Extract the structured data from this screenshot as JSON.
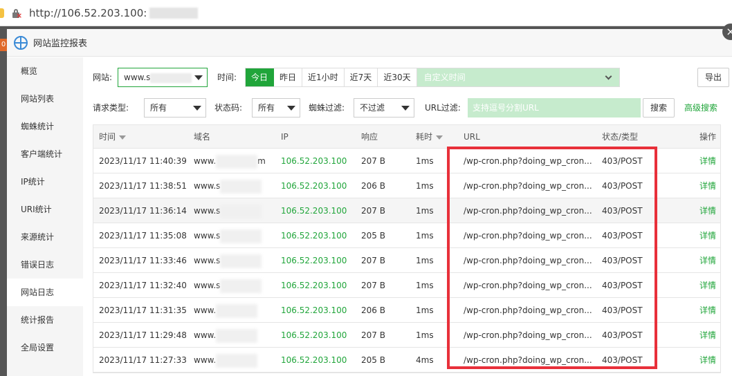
{
  "browser": {
    "url": "http://106.52.203.100:"
  },
  "dialog": {
    "title": "网站监控报表",
    "close_symbol": "×"
  },
  "sidebar": {
    "items": [
      {
        "label": "概览"
      },
      {
        "label": "网站列表"
      },
      {
        "label": "蜘蛛统计"
      },
      {
        "label": "客户端统计"
      },
      {
        "label": "IP统计"
      },
      {
        "label": "URI统计"
      },
      {
        "label": "来源统计"
      },
      {
        "label": "错误日志"
      },
      {
        "label": "网站日志",
        "active": true
      },
      {
        "label": "统计报告"
      },
      {
        "label": "全局设置"
      }
    ]
  },
  "filters": {
    "site_label": "网站:",
    "site_value": "www.s",
    "time_label": "时间:",
    "time_buttons": [
      "今日",
      "昨日",
      "近1小时",
      "近7天",
      "近30天"
    ],
    "custom_time_placeholder": "自定义时间",
    "export_label": "导出",
    "req_type_label": "请求类型:",
    "req_type_value": "所有",
    "status_label": "状态码:",
    "status_value": "所有",
    "spider_label": "蜘蛛过滤:",
    "spider_value": "不过滤",
    "url_label": "URL过滤:",
    "url_placeholder": "支持逗号分割URL",
    "search_label": "搜索",
    "advanced_label": "高级搜索"
  },
  "table": {
    "headers": [
      "时间",
      "域名",
      "IP",
      "响应",
      "耗时",
      "URL",
      "状态/类型",
      "操作"
    ],
    "rows": [
      {
        "time": "2023/11/17 11:40:39",
        "domain": "www.",
        "domain_suffix": "m",
        "ip": "106.52.203.100",
        "size": "207 B",
        "cost": "1ms",
        "url": "/wp-cron.php?doing_wp_cron...",
        "status": "403/POST",
        "op": "详情"
      },
      {
        "time": "2023/11/17 11:38:51",
        "domain": "www.s",
        "domain_suffix": "",
        "ip": "106.52.203.100",
        "size": "206 B",
        "cost": "1ms",
        "url": "/wp-cron.php?doing_wp_cron...",
        "status": "403/POST",
        "op": "详情"
      },
      {
        "time": "2023/11/17 11:36:14",
        "domain": "www.s",
        "domain_suffix": "",
        "ip": "106.52.203.100",
        "size": "207 B",
        "cost": "1ms",
        "url": "/wp-cron.php?doing_wp_cron...",
        "status": "403/POST",
        "op": "详情"
      },
      {
        "time": "2023/11/17 11:35:08",
        "domain": "www.s",
        "domain_suffix": "",
        "ip": "106.52.203.100",
        "size": "205 B",
        "cost": "1ms",
        "url": "/wp-cron.php?doing_wp_cron...",
        "status": "403/POST",
        "op": "详情"
      },
      {
        "time": "2023/11/17 11:33:46",
        "domain": "www.s",
        "domain_suffix": "",
        "ip": "106.52.203.100",
        "size": "207 B",
        "cost": "1ms",
        "url": "/wp-cron.php?doing_wp_cron...",
        "status": "403/POST",
        "op": "详情"
      },
      {
        "time": "2023/11/17 11:32:40",
        "domain": "www.s",
        "domain_suffix": "",
        "ip": "106.52.203.100",
        "size": "207 B",
        "cost": "1ms",
        "url": "/wp-cron.php?doing_wp_cron...",
        "status": "403/POST",
        "op": "详情"
      },
      {
        "time": "2023/11/17 11:31:35",
        "domain": "www.",
        "domain_suffix": "",
        "ip": "106.52.203.100",
        "size": "206 B",
        "cost": "1ms",
        "url": "/wp-cron.php?doing_wp_cron...",
        "status": "403/POST",
        "op": "详情"
      },
      {
        "time": "2023/11/17 11:29:48",
        "domain": "www.",
        "domain_suffix": "",
        "ip": "106.52.203.100",
        "size": "207 B",
        "cost": "1ms",
        "url": "/wp-cron.php?doing_wp_cron...",
        "status": "403/POST",
        "op": "详情"
      },
      {
        "time": "2023/11/17 11:27:33",
        "domain": "www.",
        "domain_suffix": "",
        "ip": "106.52.203.100",
        "size": "205 B",
        "cost": "4ms",
        "url": "/wp-cron.php?doing_wp_cron...",
        "status": "403/POST",
        "op": "详情"
      }
    ]
  },
  "colors": {
    "accent": "#20a53a",
    "highlight": "#e8303a",
    "filter_bg": "#c6ebcd"
  }
}
